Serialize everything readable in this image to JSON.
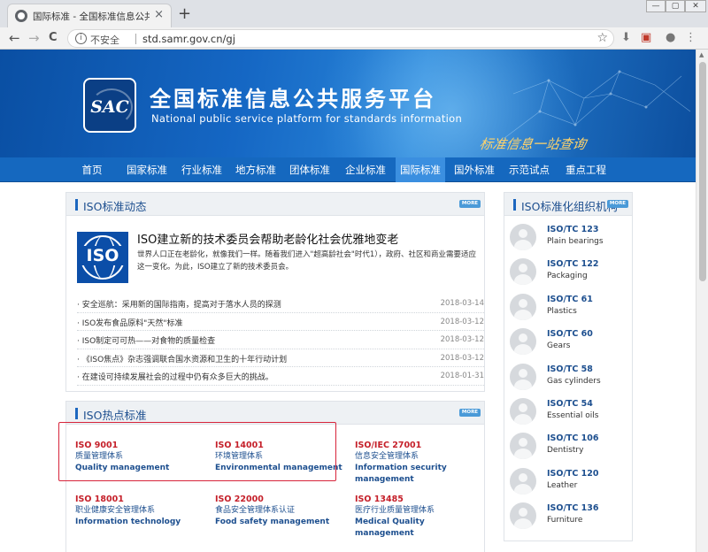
{
  "browser": {
    "tab_title": "国际标准 - 全国标准信息公共服务",
    "tab_close": "×",
    "new_tab": "+",
    "nav_back": "←",
    "nav_forward": "→",
    "nav_reload": "C",
    "security_label": "不安全",
    "info_glyph": "i",
    "url": "std.samr.gov.cn/gj",
    "star_glyph": "☆"
  },
  "header": {
    "logo_text": "SAC",
    "title": "全国标准信息公共服务平台",
    "subtitle": "National public service platform  for standards information",
    "slogan": "标准信息一站查询"
  },
  "nav": {
    "items": [
      {
        "label": "首页"
      },
      {
        "label": "国家标准"
      },
      {
        "label": "行业标准"
      },
      {
        "label": "地方标准"
      },
      {
        "label": "团体标准"
      },
      {
        "label": "企业标准"
      },
      {
        "label": "国际标准"
      },
      {
        "label": "国外标准"
      },
      {
        "label": "示范试点"
      },
      {
        "label": "重点工程"
      }
    ],
    "active_index": 6
  },
  "iso_news": {
    "title": "ISO标准动态",
    "more_label": "MORE",
    "logo_text": "ISO",
    "headline": "ISO建立新的技术委员会帮助老龄化社会优雅地变老",
    "summary": "世界人口正在老龄化，就像我们一样。随着我们进入\"超高龄社会\"时代1），政府、社区和商业需要适应这一变化。为此，ISO建立了新的技术委员会。",
    "items": [
      {
        "text": "· 安全巡航：采用新的国际指南，提高对于落水人员的探测",
        "date": "2018-03-14"
      },
      {
        "text": "· ISO发布食品原料\"天然\"标准",
        "date": "2018-03-12"
      },
      {
        "text": "· ISO制定可可热——对食物的质量检查",
        "date": "2018-03-12"
      },
      {
        "text": "· 《ISO焦点》杂志强调联合国水资源和卫生的十年行动计划",
        "date": "2018-03-12"
      },
      {
        "text": "· 在建设可持续发展社会的过程中仍有众多巨大的挑战。",
        "date": "2018-01-31"
      }
    ]
  },
  "iso_hot": {
    "title": "ISO热点标准",
    "more_label": "MORE",
    "standards": [
      {
        "code": "ISO 9001",
        "cn": "质量管理体系",
        "en": "Quality management"
      },
      {
        "code": "ISO 14001",
        "cn": "环境管理体系",
        "en": "Environmental management"
      },
      {
        "code": "ISO/IEC 27001",
        "cn": "信息安全管理体系",
        "en": "Information security management"
      },
      {
        "code": "ISO 18001",
        "cn": "职业健康安全管理体系",
        "en": "Information technology"
      },
      {
        "code": "ISO 22000",
        "cn": "食品安全管理体系认证",
        "en": "Food safety management"
      },
      {
        "code": "ISO 13485",
        "cn": "医疗行业质量管理体系",
        "en": "Medical Quality management"
      }
    ]
  },
  "iso_org": {
    "title": "ISO标准化组织机构",
    "more_label": "MORE",
    "committees": [
      {
        "code": "ISO/TC 123",
        "name": "Plain bearings"
      },
      {
        "code": "ISO/TC 122",
        "name": "Packaging"
      },
      {
        "code": "ISO/TC 61",
        "name": "Plastics"
      },
      {
        "code": "ISO/TC 60",
        "name": "Gears"
      },
      {
        "code": "ISO/TC 58",
        "name": "Gas cylinders"
      },
      {
        "code": "ISO/TC 54",
        "name": "Essential oils"
      },
      {
        "code": "ISO/TC 106",
        "name": "Dentistry"
      },
      {
        "code": "ISO/TC 120",
        "name": "Leather"
      },
      {
        "code": "ISO/TC 136",
        "name": "Furniture"
      }
    ]
  },
  "colors": {
    "brand_blue": "#1568bf",
    "accent_red": "#c5202a",
    "highlight_red": "#d7243a"
  }
}
